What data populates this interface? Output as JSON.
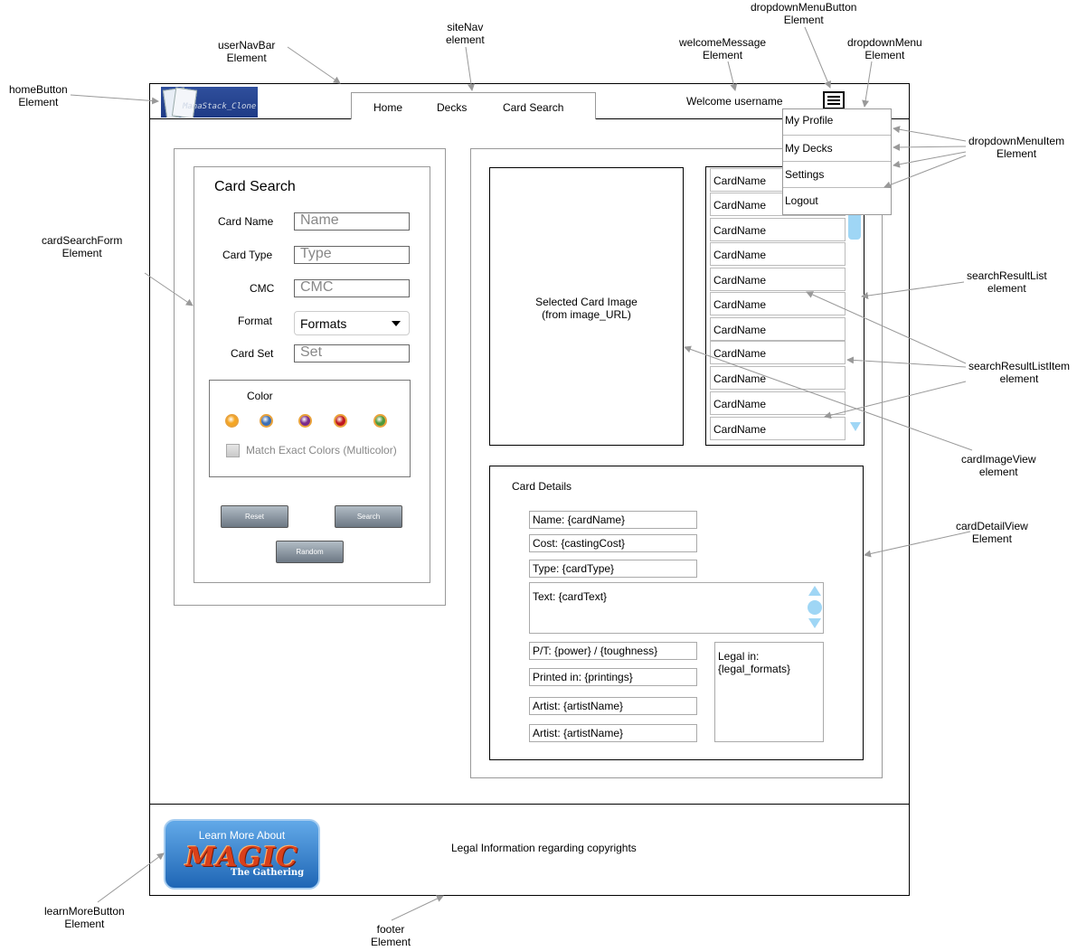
{
  "annotations": {
    "homeButton": "homeButton\nElement",
    "userNavBar": "userNavBar\nElement",
    "siteNav": "siteNav\nelement",
    "welcomeMessage": "welcomeMessage\nElement",
    "dropdownMenuButton": "dropdownMenuButton\nElement",
    "dropdownMenu": "dropdownMenu\nElement",
    "dropdownMenuItem": "dropdownMenuItem\nElement",
    "cardSearchForm": "cardSearchForm\nElement",
    "searchResultList": "searchResultList\nelement",
    "searchResultListItem": "searchResultListItem\nelement",
    "cardImageView": "cardImageView\nelement",
    "cardDetailView": "cardDetailView\nElement",
    "learnMoreButton": "learnMoreButton\nElement",
    "footer": "footer\nElement"
  },
  "header": {
    "logo_text": "ManaStack_Clone",
    "nav": [
      "Home",
      "Decks",
      "Card Search"
    ],
    "welcome": "Welcome username"
  },
  "dropdown": {
    "items": [
      "My Profile",
      "My Decks",
      "Settings",
      "Logout"
    ]
  },
  "search_form": {
    "title": "Card Search",
    "labels": {
      "name": "Card Name",
      "type": "Card Type",
      "cmc": "CMC",
      "format": "Format",
      "set": "Card Set"
    },
    "placeholders": {
      "name": "Name",
      "type": "Type",
      "cmc": "CMC",
      "set": "Set"
    },
    "format_value": "Formats",
    "color_label": "Color",
    "colors": [
      "#f5a623",
      "#3b6fb6",
      "#7b2a8c",
      "#c0181f",
      "#4f9a3a"
    ],
    "match_label": "Match Exact Colors (Multicolor)",
    "buttons": {
      "reset": "Reset",
      "search": "Search",
      "random": "Random"
    }
  },
  "image_view": {
    "line1": "Selected Card Image",
    "line2": "(from image_URL)"
  },
  "results": [
    "CardName",
    "CardName",
    "CardName",
    "CardName",
    "CardName",
    "CardName",
    "CardName",
    "CardName",
    "CardName",
    "CardName",
    "CardName"
  ],
  "details": {
    "title": "Card Details",
    "name": "Name: {cardName}",
    "cost": "Cost: {castingCost}",
    "type": "Type: {cardType}",
    "text": "Text: {cardText}",
    "pt": "P/T: {power} / {toughness}",
    "printed": "Printed in: {printings}",
    "artist1": "Artist: {artistName}",
    "artist2": "Artist: {artistName}",
    "legal_line1": "Legal in:",
    "legal_line2": "{legal_formats}"
  },
  "footer": {
    "learn_more_top": "Learn More About",
    "learn_more_logo": "MAGIC",
    "learn_more_sub": "The Gathering",
    "legal": "Legal Information regarding copyrights"
  }
}
